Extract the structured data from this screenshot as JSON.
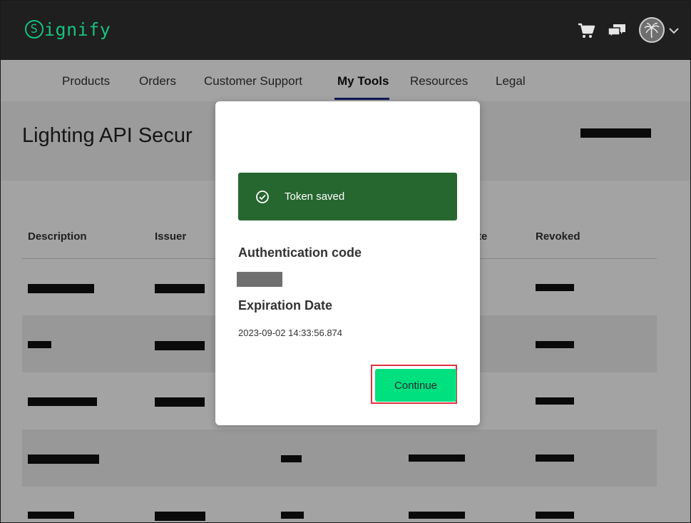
{
  "header": {
    "logo_text": "ignify",
    "logo_initial": "S",
    "icons": [
      "cart-icon",
      "chat-icon",
      "avatar",
      "chevron-down-icon"
    ]
  },
  "nav": {
    "items": [
      {
        "label": "Products"
      },
      {
        "label": "Orders"
      },
      {
        "label": "Customer Support"
      },
      {
        "label": "My Tools",
        "active": true
      },
      {
        "label": "Resources"
      },
      {
        "label": "Legal"
      }
    ]
  },
  "page": {
    "title": "Lighting API Secur"
  },
  "table": {
    "headers": [
      "Description",
      "Issuer",
      "te",
      "Revoked"
    ]
  },
  "modal": {
    "toast_text": "Token saved",
    "auth_label": "Authentication code",
    "expiration_label": "Expiration Date",
    "expiration_value": "2023-09-02 14:33:56.874",
    "continue_label": "Continue"
  },
  "colors": {
    "brand_green": "#16c17e",
    "toast_green": "#26672f",
    "button_green": "#00e07f",
    "highlight_red": "#e5313d",
    "nav_underline": "#1a2a8a"
  }
}
